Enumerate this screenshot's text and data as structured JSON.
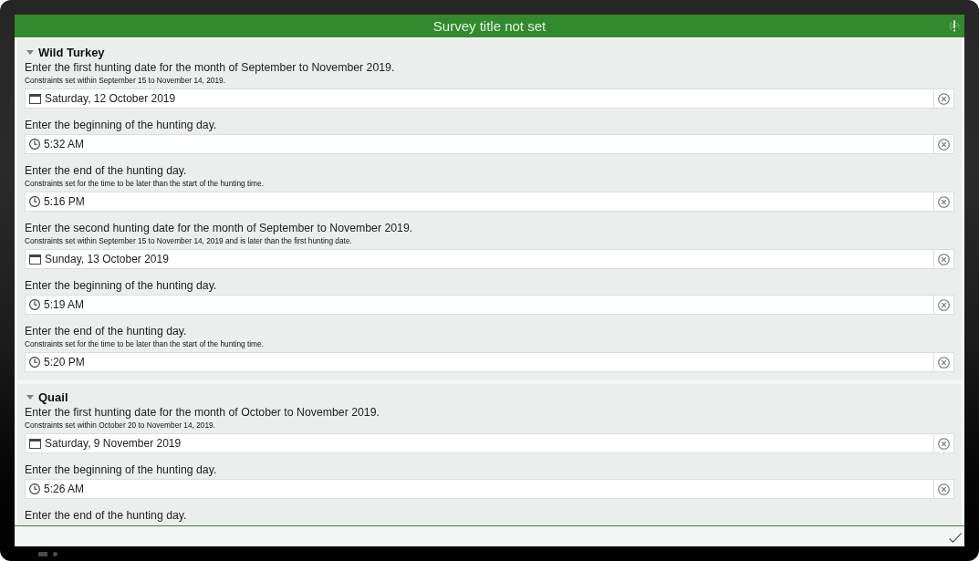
{
  "window": {
    "title": "Survey title not set"
  },
  "groups": [
    {
      "title": "Wild Turkey",
      "expanded": true,
      "questions": [
        {
          "label": "Enter the first hunting date for the month of September to November 2019.",
          "hint": "Constraints set within September 15 to November 14, 2019.",
          "kind": "date",
          "value": "Saturday, 12 October 2019"
        },
        {
          "label": "Enter the beginning of the hunting day.",
          "kind": "time",
          "value": "5:32 AM"
        },
        {
          "label": "Enter the end of the hunting day.",
          "hint": "Constraints set for the time to be later than the start of the hunting time.",
          "kind": "time",
          "value": "5:16 PM"
        },
        {
          "label": "Enter the second hunting date for the month of September to November 2019.",
          "hint": "Constraints set within September 15 to November 14, 2019 and is later than the first hunting date.",
          "kind": "date",
          "value": "Sunday, 13 October 2019"
        },
        {
          "label": "Enter the beginning of the hunting day.",
          "kind": "time",
          "value": "5:19 AM"
        },
        {
          "label": "Enter the end of the hunting day.",
          "hint": "Constraints set for the time to be later than the start of the hunting time.",
          "kind": "time",
          "value": "5:20 PM"
        }
      ]
    },
    {
      "title": "Quail",
      "expanded": true,
      "questions": [
        {
          "label": "Enter the first hunting date for the month of October to November 2019.",
          "hint": "Constraints set within October 20 to November 14, 2019.",
          "kind": "date",
          "value": "Saturday, 9 November 2019"
        },
        {
          "label": "Enter the beginning of the hunting day.",
          "kind": "time",
          "value": "5:26 AM"
        },
        {
          "label": "Enter the end of the hunting day."
        }
      ]
    }
  ]
}
